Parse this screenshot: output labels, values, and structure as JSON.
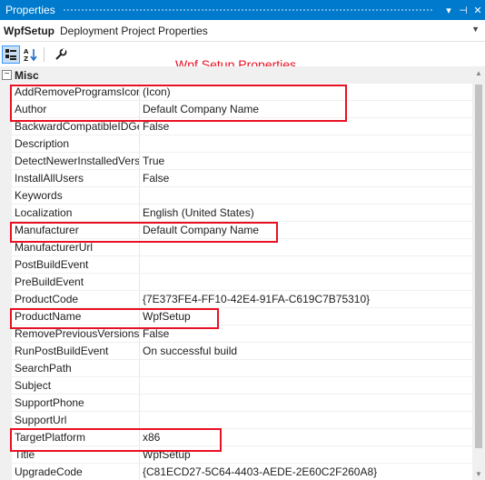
{
  "window": {
    "title": "Properties",
    "dropdown_glyph": "▾",
    "pin_glyph": "⊣",
    "close_glyph": "✕"
  },
  "object": {
    "name": "WpfSetup",
    "type": "Deployment Project Properties"
  },
  "annotation": "Wpf Setup Properties",
  "toolbar": {
    "icons": [
      "categorized-icon",
      "alphabetical-icon",
      "property-pages-icon"
    ]
  },
  "category": {
    "toggle": "−",
    "label": "Misc"
  },
  "properties": [
    {
      "name": "AddRemoveProgramsIcon",
      "value": "(Icon)"
    },
    {
      "name": "Author",
      "value": "Default Company Name"
    },
    {
      "name": "BackwardCompatibleIDGeneration",
      "value": "False"
    },
    {
      "name": "Description",
      "value": ""
    },
    {
      "name": "DetectNewerInstalledVersion",
      "value": "True"
    },
    {
      "name": "InstallAllUsers",
      "value": "False"
    },
    {
      "name": "Keywords",
      "value": ""
    },
    {
      "name": "Localization",
      "value": "English (United States)"
    },
    {
      "name": "Manufacturer",
      "value": "Default Company Name"
    },
    {
      "name": "ManufacturerUrl",
      "value": ""
    },
    {
      "name": "PostBuildEvent",
      "value": ""
    },
    {
      "name": "PreBuildEvent",
      "value": ""
    },
    {
      "name": "ProductCode",
      "value": "{7E373FE4-FF10-42E4-91FA-C619C7B75310}"
    },
    {
      "name": "ProductName",
      "value": "WpfSetup"
    },
    {
      "name": "RemovePreviousVersions",
      "value": "False"
    },
    {
      "name": "RunPostBuildEvent",
      "value": "On successful build"
    },
    {
      "name": "SearchPath",
      "value": ""
    },
    {
      "name": "Subject",
      "value": ""
    },
    {
      "name": "SupportPhone",
      "value": ""
    },
    {
      "name": "SupportUrl",
      "value": ""
    },
    {
      "name": "TargetPlatform",
      "value": "x86"
    },
    {
      "name": "Title",
      "value": "WpfSetup"
    },
    {
      "name": "UpgradeCode",
      "value": "{C81ECD27-5C64-4403-AEDE-2E60C2F260A8}"
    }
  ],
  "colors": {
    "accent": "#007acc",
    "highlight": "#e81123"
  }
}
